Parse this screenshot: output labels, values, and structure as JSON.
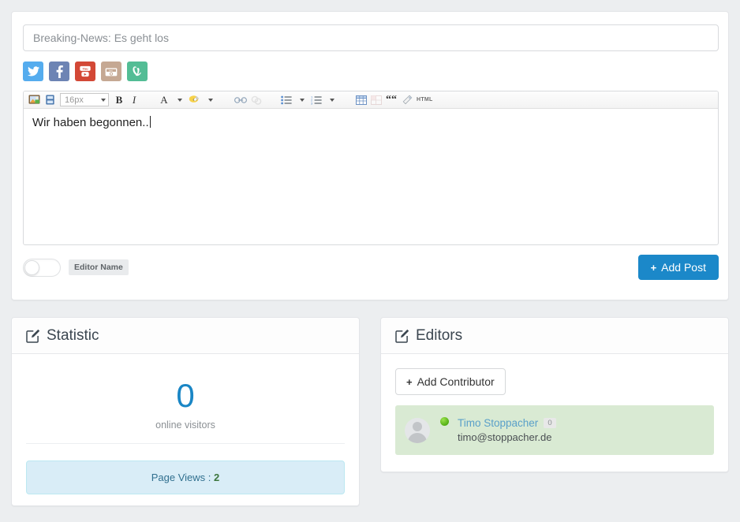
{
  "composer": {
    "title_value": "Breaking-News: Es geht los",
    "title_placeholder": "Breaking-News: Es geht los",
    "social": [
      {
        "name": "twitter",
        "label": "Twitter",
        "color": "#55acee"
      },
      {
        "name": "facebook",
        "label": "Facebook",
        "color": "#6d84b4"
      },
      {
        "name": "youtube",
        "label": "YouTube",
        "color": "#d34836"
      },
      {
        "name": "instagram",
        "label": "Instagram",
        "color": "#c5a893"
      },
      {
        "name": "vine",
        "label": "Vine",
        "color": "#53bd95"
      }
    ],
    "toolbar": {
      "fontsize_value": "16px",
      "bold_label": "B",
      "italic_label": "I",
      "fontcolor_label": "A",
      "highlight_label": "ab",
      "quote_label": "““",
      "html_label": "HTML"
    },
    "editor_text": "Wir haben begonnen..",
    "editor_name_label": "Editor Name",
    "add_post_label": "Add Post",
    "add_post_plus": "+",
    "add_post_color": "#1b88c9"
  },
  "statistic": {
    "panel_title": "Statistic",
    "count": "0",
    "count_color": "#1a86c5",
    "caption": "online visitors",
    "pageviews_label": "Page Views :",
    "pageviews_value": "2",
    "pageviews_value_color": "#3c763d"
  },
  "editors": {
    "panel_title": "Editors",
    "add_contributor_label": "Add Contributor",
    "add_contributor_plus": "+",
    "list": [
      {
        "name": "Timo Stoppacher",
        "badge": "0",
        "email": "timo@stoppacher.de",
        "status": "online",
        "row_color": "#d9ead3"
      }
    ]
  }
}
